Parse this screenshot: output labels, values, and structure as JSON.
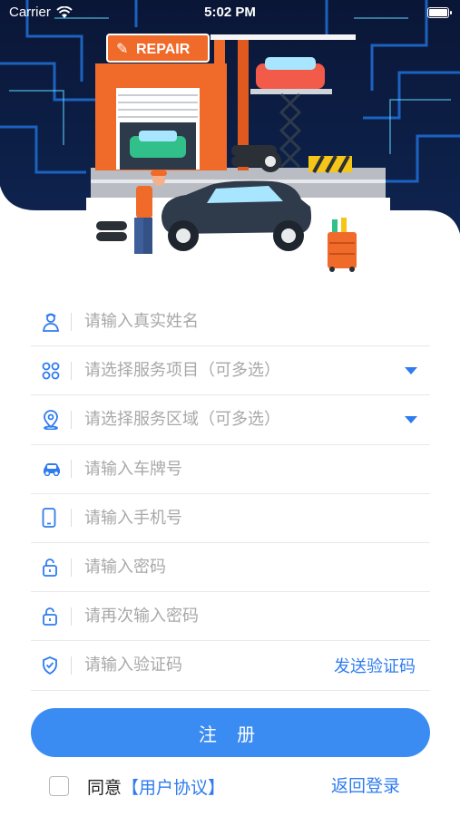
{
  "status_bar": {
    "carrier": "Carrier",
    "time": "5:02 PM"
  },
  "hero": {
    "sign_text": "REPAIR"
  },
  "form": {
    "name_placeholder": "请输入真实姓名",
    "service_items_placeholder": "请选择服务项目（可多选）",
    "service_area_placeholder": "请选择服务区域（可多选）",
    "plate_placeholder": "请输入车牌号",
    "phone_placeholder": "请输入手机号",
    "password_placeholder": "请输入密码",
    "password_confirm_placeholder": "请再次输入密码",
    "code_placeholder": "请输入验证码",
    "send_code_label": "发送验证码"
  },
  "submit_label": "注 册",
  "agreement": {
    "prefix": "同意",
    "link": "【用户协议】"
  },
  "back_login_label": "返回登录",
  "colors": {
    "accent": "#3a8cf3",
    "header_bg": "#0c1a3a",
    "orange": "#f06a2a"
  }
}
